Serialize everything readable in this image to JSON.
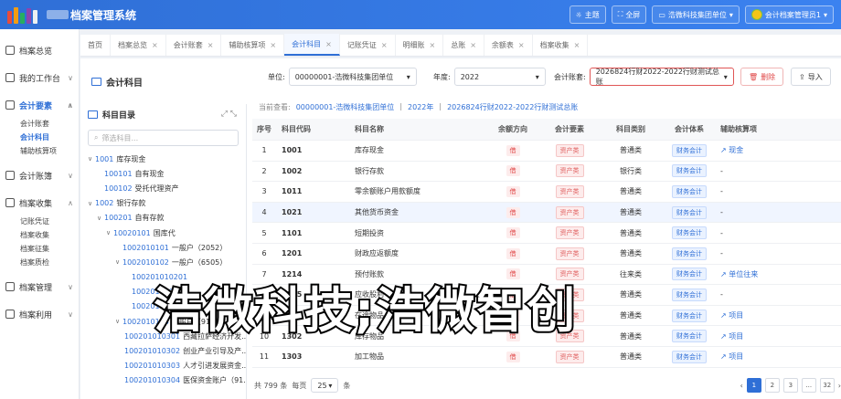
{
  "app": {
    "title": "档案管理系统"
  },
  "top": {
    "theme": "主题",
    "fullscreen": "全屏",
    "org": "浩微科技集团单位",
    "user": "会计档案管理员1"
  },
  "sidebar": [
    {
      "label": "档案总览",
      "icon": "home-icon"
    },
    {
      "label": "我的工作台",
      "icon": "user-icon",
      "caret": true
    },
    {
      "label": "会计要素",
      "icon": "grid-icon",
      "caret": true,
      "active": true,
      "children": [
        "会计账套",
        "会计科目",
        "辅助核算项"
      ]
    },
    {
      "label": "会计账簿",
      "icon": "book-icon",
      "caret": true
    },
    {
      "label": "档案收集",
      "icon": "stack-icon",
      "caret": true,
      "children": [
        "记账凭证",
        "档案收集",
        "档案征集",
        "档案质检"
      ]
    },
    {
      "label": "档案管理",
      "icon": "gear-icon",
      "caret": true
    },
    {
      "label": "档案利用",
      "icon": "share-icon",
      "caret": true
    }
  ],
  "tabs": [
    "首页",
    "档案总览",
    "会计账套",
    "辅助核算项",
    "会计科目",
    "记账凭证",
    "明细账",
    "总账",
    "余额表",
    "档案收集"
  ],
  "page": {
    "title": "会计科目"
  },
  "filters": {
    "unit_label": "单位:",
    "unit_value": "00000001-浩微科技集团单位",
    "year_label": "年度:",
    "year_value": "2022",
    "book_label": "会计账套:",
    "book_value": "2026824行财2022-2022行财测试总账",
    "delete": "删除",
    "import": "导入"
  },
  "tree": {
    "title": "科目目录",
    "search_placeholder": "筛选科目...",
    "nodes": [
      {
        "d": 0,
        "arrow": "∨",
        "code": "1001",
        "name": "库存现金"
      },
      {
        "d": 1,
        "arrow": "",
        "code": "100101",
        "name": "自有现金"
      },
      {
        "d": 1,
        "arrow": "",
        "code": "100102",
        "name": "受托代理资产"
      },
      {
        "d": 0,
        "arrow": "∨",
        "code": "1002",
        "name": "银行存款"
      },
      {
        "d": 1,
        "arrow": "∨",
        "code": "100201",
        "name": "自有存款"
      },
      {
        "d": 2,
        "arrow": "∨",
        "code": "10020101",
        "name": "国库代"
      },
      {
        "d": 3,
        "arrow": "",
        "code": "1002010101",
        "name": "一般户（2052）"
      },
      {
        "d": 3,
        "arrow": "∨",
        "code": "1002010102",
        "name": "一般户（6505）"
      },
      {
        "d": 4,
        "arrow": "",
        "code": "100201010201",
        "name": ""
      },
      {
        "d": 4,
        "arrow": "",
        "code": "100201010202",
        "name": ""
      },
      {
        "d": 4,
        "arrow": "",
        "code": "100201010203",
        "name": ""
      },
      {
        "d": 3,
        "arrow": "∨",
        "code": "1002010103",
        "name": "一般户（91..."
      },
      {
        "d": 4,
        "arrow": "",
        "code": "100201010301",
        "name": "西藏拉萨经济开发..."
      },
      {
        "d": 4,
        "arrow": "",
        "code": "100201010302",
        "name": "创业产业引导及产..."
      },
      {
        "d": 4,
        "arrow": "",
        "code": "100201010303",
        "name": "人才引进发展资金..."
      },
      {
        "d": 4,
        "arrow": "",
        "code": "100201010304",
        "name": "医保资金账户（91..."
      }
    ]
  },
  "crumb": {
    "label": "当前查看:",
    "unit": "00000001-浩微科技集团单位",
    "year": "2022年",
    "book": "2026824行财2022-2022行财测试总账"
  },
  "table": {
    "headers": [
      "序号",
      "科目代码",
      "科目名称",
      "余额方向",
      "会计要素",
      "科目类别",
      "会计体系",
      "辅助核算项"
    ],
    "rows": [
      [
        "1",
        "1001",
        "库存现金",
        "借",
        "资产类",
        "普通类",
        "财务会计",
        "现金"
      ],
      [
        "2",
        "1002",
        "银行存款",
        "借",
        "资产类",
        "银行类",
        "财务会计",
        "-"
      ],
      [
        "3",
        "1011",
        "零余额账户用款额度",
        "借",
        "资产类",
        "普通类",
        "财务会计",
        "-"
      ],
      [
        "4",
        "1021",
        "其他货币资金",
        "借",
        "资产类",
        "普通类",
        "财务会计",
        "-"
      ],
      [
        "5",
        "1101",
        "短期投资",
        "借",
        "资产类",
        "普通类",
        "财务会计",
        "-"
      ],
      [
        "6",
        "1201",
        "财政应返额度",
        "借",
        "资产类",
        "普通类",
        "财务会计",
        "-"
      ],
      [
        "7",
        "1214",
        "预付账款",
        "借",
        "资产类",
        "往来类",
        "财务会计",
        "单位往来"
      ],
      [
        "8",
        "1215",
        "应收股利",
        "借",
        "资产类",
        "普通类",
        "财务会计",
        "-"
      ],
      [
        "9",
        "1301",
        "在途物品",
        "借",
        "资产类",
        "普通类",
        "财务会计",
        "项目"
      ],
      [
        "10",
        "1302",
        "库存物品",
        "借",
        "资产类",
        "普通类",
        "财务会计",
        "项目"
      ],
      [
        "11",
        "1303",
        "加工物品",
        "借",
        "资产类",
        "普通类",
        "财务会计",
        "项目"
      ]
    ]
  },
  "footer": {
    "total": "共 799 条",
    "per_page_label": "每页",
    "per_page": "25",
    "per_page_unit": "条",
    "pages": [
      "1",
      "2",
      "3",
      "...",
      "32"
    ]
  },
  "watermark": "浩微科技;浩微智创",
  "colors": {
    "primary": "#2f6fd6",
    "danger": "#e04848"
  }
}
